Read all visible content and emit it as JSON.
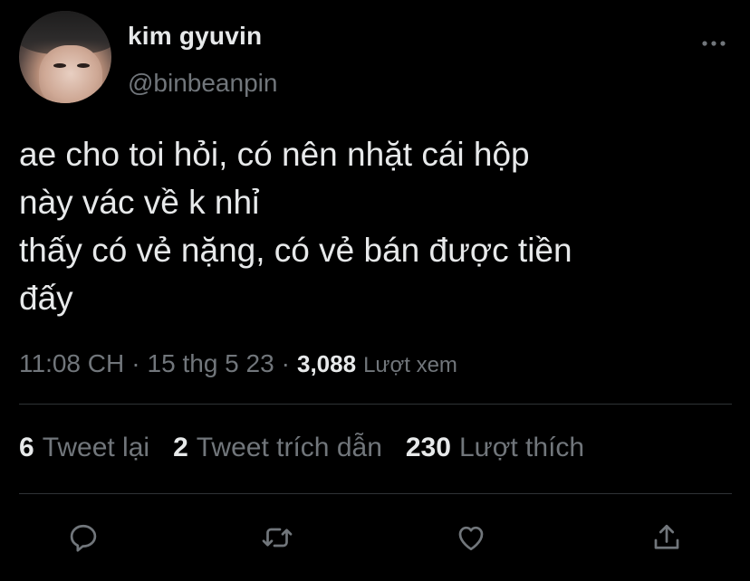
{
  "author": {
    "display_name": "kim gyuvin",
    "handle": "@binbeanpin"
  },
  "tweet": {
    "lines": [
      "ae cho toi hỏi, có nên nhặt cái hộp",
      "này vác về k nhỉ",
      "thấy có vẻ nặng, có vẻ bán được tiền",
      "đấy"
    ],
    "time": "11:08 CH",
    "date": "15 thg 5 23",
    "separator": "·",
    "views_count": "3,088",
    "views_label": "Lượt xem"
  },
  "stats": {
    "retweets_count": "6",
    "retweets_label": "Tweet lại",
    "quotes_count": "2",
    "quotes_label": "Tweet trích dẫn",
    "likes_count": "230",
    "likes_label": "Lượt thích"
  },
  "icons": {
    "more": "more-horizontal-icon",
    "reply": "reply-icon",
    "retweet": "retweet-icon",
    "like": "heart-icon",
    "share": "share-icon"
  },
  "colors": {
    "background": "#000000",
    "text_primary": "#e7e9ea",
    "text_secondary": "#71767b",
    "divider": "#2f3336"
  }
}
